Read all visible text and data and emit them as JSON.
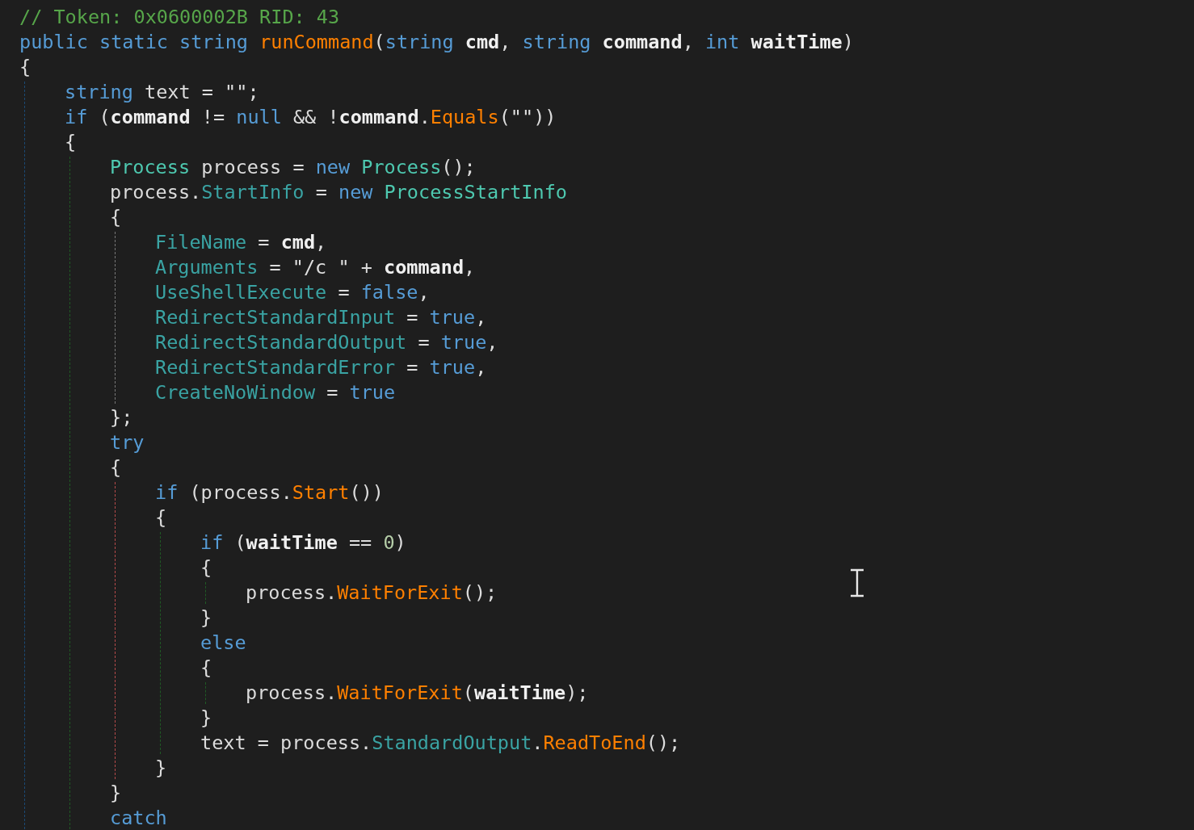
{
  "editor": {
    "lines": [
      {
        "tokens": [
          {
            "kind": "comment",
            "text": "// Token: 0x0600002B RID: 43"
          }
        ]
      },
      {
        "tokens": [
          {
            "kind": "keyword",
            "text": "public static string "
          },
          {
            "kind": "method",
            "text": "runCommand"
          },
          {
            "kind": "plain",
            "text": "("
          },
          {
            "kind": "keyword",
            "text": "string "
          },
          {
            "kind": "param",
            "text": "cmd"
          },
          {
            "kind": "plain",
            "text": ", "
          },
          {
            "kind": "keyword",
            "text": "string "
          },
          {
            "kind": "param",
            "text": "command"
          },
          {
            "kind": "plain",
            "text": ", "
          },
          {
            "kind": "keyword",
            "text": "int "
          },
          {
            "kind": "param",
            "text": "waitTime"
          },
          {
            "kind": "plain",
            "text": ")"
          }
        ]
      },
      {
        "tokens": [
          {
            "kind": "plain",
            "text": "{"
          }
        ],
        "color": "#1b4a75",
        "children": [
          {
            "tokens": [
              {
                "kind": "keyword",
                "text": "string"
              },
              {
                "kind": "plain",
                "text": " text = "
              },
              {
                "kind": "string",
                "text": "\"\""
              },
              {
                "kind": "plain",
                "text": ";"
              }
            ]
          },
          {
            "tokens": [
              {
                "kind": "keyword",
                "text": "if"
              },
              {
                "kind": "plain",
                "text": " ("
              },
              {
                "kind": "param",
                "text": "command"
              },
              {
                "kind": "plain",
                "text": " != "
              },
              {
                "kind": "keyword",
                "text": "null"
              },
              {
                "kind": "plain",
                "text": " && !"
              },
              {
                "kind": "param",
                "text": "command"
              },
              {
                "kind": "plain",
                "text": "."
              },
              {
                "kind": "method",
                "text": "Equals"
              },
              {
                "kind": "plain",
                "text": "("
              },
              {
                "kind": "string",
                "text": "\"\""
              },
              {
                "kind": "plain",
                "text": "))"
              }
            ]
          },
          {
            "tokens": [
              {
                "kind": "plain",
                "text": "{"
              }
            ],
            "color": "#1f5a24",
            "children": [
              {
                "tokens": [
                  {
                    "kind": "type",
                    "text": "Process"
                  },
                  {
                    "kind": "plain",
                    "text": " process = "
                  },
                  {
                    "kind": "keyword",
                    "text": "new "
                  },
                  {
                    "kind": "type",
                    "text": "Process"
                  },
                  {
                    "kind": "plain",
                    "text": "();"
                  }
                ]
              },
              {
                "tokens": [
                  {
                    "kind": "plain",
                    "text": "process."
                  },
                  {
                    "kind": "property",
                    "text": "StartInfo"
                  },
                  {
                    "kind": "plain",
                    "text": " = "
                  },
                  {
                    "kind": "keyword",
                    "text": "new "
                  },
                  {
                    "kind": "type",
                    "text": "ProcessStartInfo"
                  }
                ]
              },
              {
                "tokens": [
                  {
                    "kind": "plain",
                    "text": "{"
                  }
                ],
                "color": "#777777",
                "children": [
                  {
                    "tokens": [
                      {
                        "kind": "property",
                        "text": "FileName"
                      },
                      {
                        "kind": "plain",
                        "text": " = "
                      },
                      {
                        "kind": "param",
                        "text": "cmd"
                      },
                      {
                        "kind": "plain",
                        "text": ","
                      }
                    ]
                  },
                  {
                    "tokens": [
                      {
                        "kind": "property",
                        "text": "Arguments"
                      },
                      {
                        "kind": "plain",
                        "text": " = "
                      },
                      {
                        "kind": "string",
                        "text": "\"/c \""
                      },
                      {
                        "kind": "plain",
                        "text": " + "
                      },
                      {
                        "kind": "param",
                        "text": "command"
                      },
                      {
                        "kind": "plain",
                        "text": ","
                      }
                    ]
                  },
                  {
                    "tokens": [
                      {
                        "kind": "property",
                        "text": "UseShellExecute"
                      },
                      {
                        "kind": "plain",
                        "text": " = "
                      },
                      {
                        "kind": "keyword",
                        "text": "false"
                      },
                      {
                        "kind": "plain",
                        "text": ","
                      }
                    ]
                  },
                  {
                    "tokens": [
                      {
                        "kind": "property",
                        "text": "RedirectStandardInput"
                      },
                      {
                        "kind": "plain",
                        "text": " = "
                      },
                      {
                        "kind": "keyword",
                        "text": "true"
                      },
                      {
                        "kind": "plain",
                        "text": ","
                      }
                    ]
                  },
                  {
                    "tokens": [
                      {
                        "kind": "property",
                        "text": "RedirectStandardOutput"
                      },
                      {
                        "kind": "plain",
                        "text": " = "
                      },
                      {
                        "kind": "keyword",
                        "text": "true"
                      },
                      {
                        "kind": "plain",
                        "text": ","
                      }
                    ]
                  },
                  {
                    "tokens": [
                      {
                        "kind": "property",
                        "text": "RedirectStandardError"
                      },
                      {
                        "kind": "plain",
                        "text": " = "
                      },
                      {
                        "kind": "keyword",
                        "text": "true"
                      },
                      {
                        "kind": "plain",
                        "text": ","
                      }
                    ]
                  },
                  {
                    "tokens": [
                      {
                        "kind": "property",
                        "text": "CreateNoWindow"
                      },
                      {
                        "kind": "plain",
                        "text": " = "
                      },
                      {
                        "kind": "keyword",
                        "text": "true"
                      }
                    ]
                  }
                ]
              },
              {
                "tokens": [
                  {
                    "kind": "plain",
                    "text": "};"
                  }
                ]
              },
              {
                "tokens": [
                  {
                    "kind": "keyword",
                    "text": "try"
                  }
                ]
              },
              {
                "tokens": [
                  {
                    "kind": "plain",
                    "text": "{"
                  }
                ],
                "color": "#b54a4a",
                "children": [
                  {
                    "tokens": [
                      {
                        "kind": "keyword",
                        "text": "if"
                      },
                      {
                        "kind": "plain",
                        "text": " (process."
                      },
                      {
                        "kind": "method",
                        "text": "Start"
                      },
                      {
                        "kind": "plain",
                        "text": "())"
                      }
                    ]
                  },
                  {
                    "tokens": [
                      {
                        "kind": "plain",
                        "text": "{"
                      }
                    ],
                    "color": "#1f5a24",
                    "children": [
                      {
                        "tokens": [
                          {
                            "kind": "keyword",
                            "text": "if"
                          },
                          {
                            "kind": "plain",
                            "text": " ("
                          },
                          {
                            "kind": "param",
                            "text": "waitTime"
                          },
                          {
                            "kind": "plain",
                            "text": " == "
                          },
                          {
                            "kind": "number",
                            "text": "0"
                          },
                          {
                            "kind": "plain",
                            "text": ")"
                          }
                        ]
                      },
                      {
                        "tokens": [
                          {
                            "kind": "plain",
                            "text": "{"
                          }
                        ],
                        "color": "#1f5a24",
                        "children": [
                          {
                            "tokens": [
                              {
                                "kind": "plain",
                                "text": "process."
                              },
                              {
                                "kind": "method",
                                "text": "WaitForExit"
                              },
                              {
                                "kind": "plain",
                                "text": "();"
                              }
                            ]
                          }
                        ]
                      },
                      {
                        "tokens": [
                          {
                            "kind": "plain",
                            "text": "}"
                          }
                        ]
                      },
                      {
                        "tokens": [
                          {
                            "kind": "keyword",
                            "text": "else"
                          }
                        ]
                      },
                      {
                        "tokens": [
                          {
                            "kind": "plain",
                            "text": "{"
                          }
                        ],
                        "color": "#1f5a24",
                        "children": [
                          {
                            "tokens": [
                              {
                                "kind": "plain",
                                "text": "process."
                              },
                              {
                                "kind": "method",
                                "text": "WaitForExit"
                              },
                              {
                                "kind": "plain",
                                "text": "("
                              },
                              {
                                "kind": "param",
                                "text": "waitTime"
                              },
                              {
                                "kind": "plain",
                                "text": ");"
                              }
                            ]
                          }
                        ]
                      },
                      {
                        "tokens": [
                          {
                            "kind": "plain",
                            "text": "}"
                          }
                        ]
                      },
                      {
                        "tokens": [
                          {
                            "kind": "plain",
                            "text": "text = process."
                          },
                          {
                            "kind": "property",
                            "text": "StandardOutput"
                          },
                          {
                            "kind": "plain",
                            "text": "."
                          },
                          {
                            "kind": "method",
                            "text": "ReadToEnd"
                          },
                          {
                            "kind": "plain",
                            "text": "();"
                          }
                        ]
                      }
                    ]
                  },
                  {
                    "tokens": [
                      {
                        "kind": "plain",
                        "text": "}"
                      }
                    ]
                  }
                ]
              },
              {
                "tokens": [
                  {
                    "kind": "plain",
                    "text": "}"
                  }
                ]
              },
              {
                "tokens": [
                  {
                    "kind": "keyword",
                    "text": "catch"
                  }
                ]
              }
            ]
          }
        ]
      }
    ]
  }
}
